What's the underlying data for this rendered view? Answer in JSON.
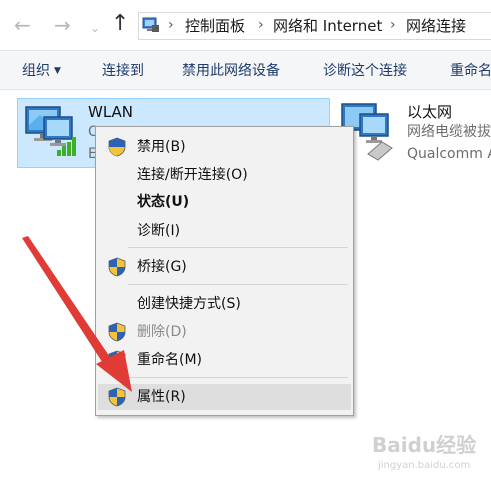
{
  "address_bar": {
    "crumbs": [
      "控制面板",
      "网络和 Internet",
      "网络连接"
    ]
  },
  "toolbar": {
    "organize": "组织",
    "connect_to": "连接到",
    "disable_device": "禁用此网络设备",
    "diagnose": "诊断这个连接",
    "rename": "重命名"
  },
  "items": {
    "wlan": {
      "name": "WLAN",
      "status_letter": "C",
      "device_letter": "E"
    },
    "ethernet": {
      "name": "以太网",
      "status": "网络电缆被拔",
      "device": "Qualcomm A"
    }
  },
  "context_menu": {
    "items": [
      {
        "label": "禁用(B)",
        "shield": true
      },
      {
        "label": "连接/断开连接(O)"
      },
      {
        "label": "状态(U)",
        "bold": true
      },
      {
        "label": "诊断(I)"
      },
      {
        "label": "桥接(G)",
        "shield": true
      },
      {
        "label": "创建快捷方式(S)"
      },
      {
        "label": "删除(D)",
        "shield": true,
        "disabled": true
      },
      {
        "label": "重命名(M)",
        "shield": true
      },
      {
        "label": "属性(R)",
        "shield": true,
        "highlighted": true
      }
    ]
  },
  "watermark": {
    "logo": "Baidu经验",
    "url": "jingyan.baidu.com"
  },
  "colors": {
    "selection": "#cce8ff",
    "menu_bg": "#f2f2f2",
    "arrow": "#e03b35",
    "signal": "#3fae2a"
  }
}
